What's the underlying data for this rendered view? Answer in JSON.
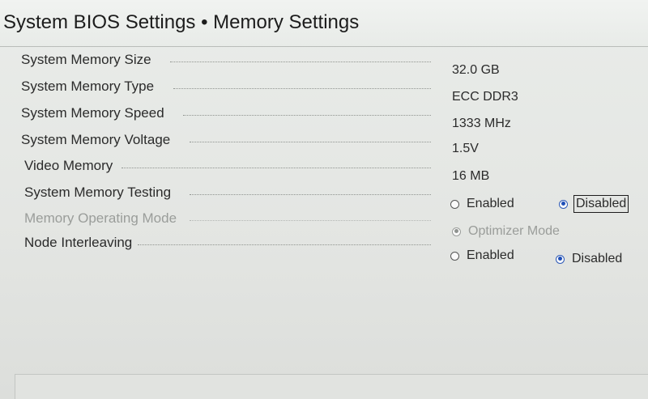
{
  "header": {
    "title": "System BIOS Settings • Memory Settings"
  },
  "settings": [
    {
      "label": "System Memory Size",
      "value": "32.0 GB"
    },
    {
      "label": "System Memory Type",
      "value": "ECC DDR3"
    },
    {
      "label": "System Memory Speed",
      "value": "1333 MHz"
    },
    {
      "label": "System Memory Voltage",
      "value": "1.5V"
    },
    {
      "label": "Video Memory",
      "value": "16 MB"
    },
    {
      "label": "System Memory Testing",
      "options": [
        "Enabled",
        "Disabled"
      ],
      "selected": "Disabled",
      "focused": true
    },
    {
      "label": "Memory Operating Mode",
      "options": [
        "Optimizer Mode"
      ],
      "selected": "Optimizer Mode",
      "disabled": true
    },
    {
      "label": "Node Interleaving",
      "options": [
        "Enabled",
        "Disabled"
      ],
      "selected": "Disabled"
    }
  ],
  "colors": {
    "background": "#e6e8e5",
    "radio_selected": "#1f4fb8",
    "disabled_text": "#9a9d9a"
  }
}
